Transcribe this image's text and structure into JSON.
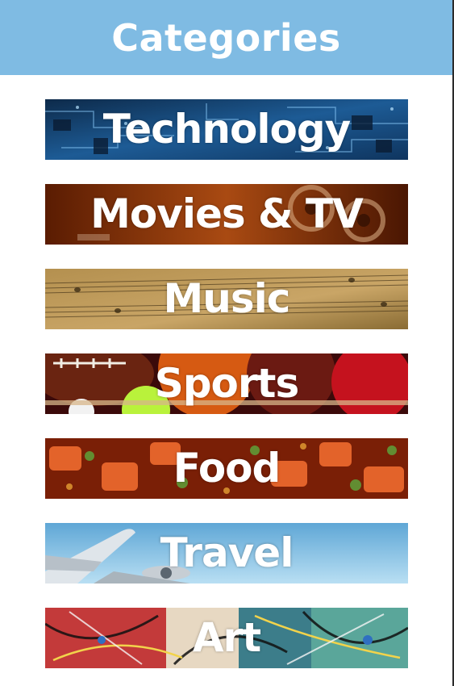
{
  "header": {
    "title": "Categories",
    "background": "#7fbbe3"
  },
  "categories": [
    {
      "label": "Technology",
      "image": "circuit-board-image",
      "accent": "#1f5f9e"
    },
    {
      "label": "Movies & TV",
      "image": "film-reel-image",
      "accent": "#9a3a08"
    },
    {
      "label": "Music",
      "image": "sheet-music-image",
      "accent": "#a77c35"
    },
    {
      "label": "Sports",
      "image": "sports-balls-image",
      "accent": "#b3121b"
    },
    {
      "label": "Food",
      "image": "spicy-dish-image",
      "accent": "#c24a1a"
    },
    {
      "label": "Travel",
      "image": "airplane-sky-image",
      "accent": "#6fb3e0"
    },
    {
      "label": "Art",
      "image": "abstract-paint-image",
      "accent": "#c0392b"
    }
  ]
}
